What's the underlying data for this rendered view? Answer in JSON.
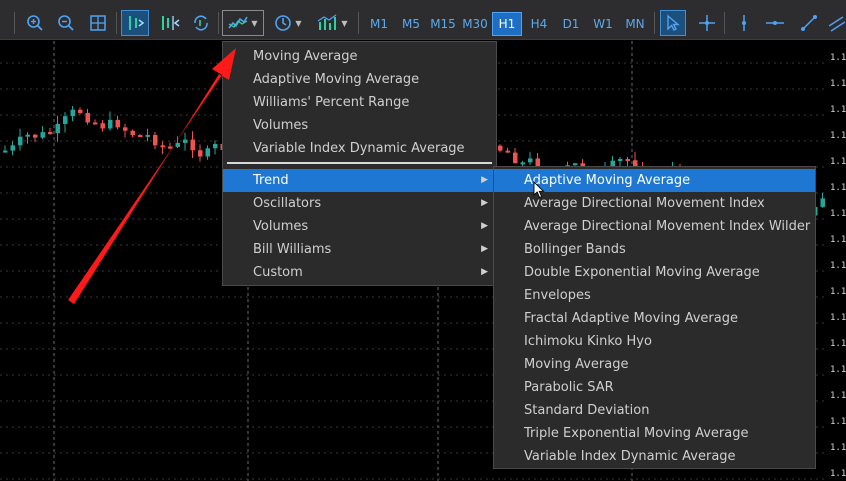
{
  "toolbar": {
    "timeframes": [
      "M1",
      "M5",
      "M15",
      "M30",
      "H1",
      "H4",
      "D1",
      "W1",
      "MN"
    ],
    "active_timeframe": "H1",
    "accent_color": "#1e6fc4"
  },
  "indicator_menu": {
    "recent": [
      "Moving Average",
      "Adaptive Moving Average",
      "Williams' Percent Range",
      "Volumes",
      "Variable Index Dynamic Average"
    ],
    "categories": [
      "Trend",
      "Oscillators",
      "Volumes",
      "Bill Williams",
      "Custom"
    ],
    "highlighted_category": "Trend"
  },
  "trend_submenu": {
    "items": [
      "Adaptive Moving Average",
      "Average Directional Movement Index",
      "Average Directional Movement Index Wilder",
      "Bollinger Bands",
      "Double Exponential Moving Average",
      "Envelopes",
      "Fractal Adaptive Moving Average",
      "Ichimoku Kinko Hyo",
      "Moving Average",
      "Parabolic SAR",
      "Standard Deviation",
      "Triple Exponential Moving Average",
      "Variable Index Dynamic Average"
    ],
    "highlighted_item": "Adaptive Moving Average"
  },
  "price_axis": {
    "labels": [
      "1.1",
      "1.1",
      "1.1",
      "1.1",
      "1.1",
      "1.1",
      "1.1",
      "1.1",
      "1.1",
      "1.1",
      "1.1",
      "1.1",
      "1.1",
      "1.1",
      "1.1",
      "1.1",
      "1.1"
    ]
  },
  "colors": {
    "bull_candle": "#26a69a",
    "bear_candle": "#ef5350",
    "annotation_arrow": "#ff1a1a",
    "highlight": "#1e77d2"
  }
}
